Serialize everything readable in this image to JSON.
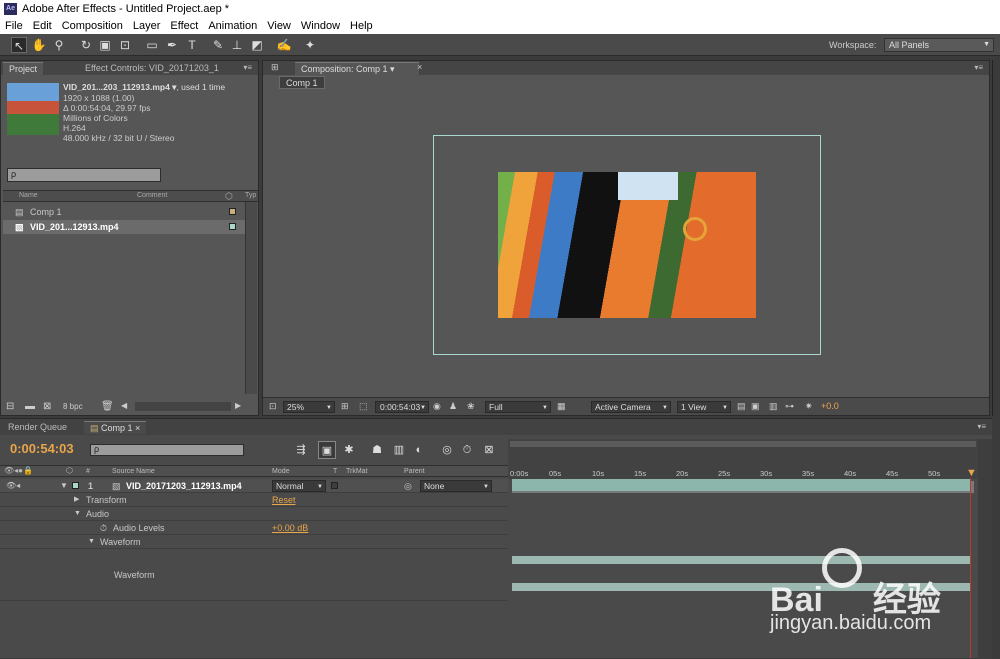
{
  "window": {
    "title": "Adobe After Effects - Untitled Project.aep *",
    "app_icon": "Ae"
  },
  "menu": [
    "File",
    "Edit",
    "Composition",
    "Layer",
    "Effect",
    "Animation",
    "View",
    "Window",
    "Help"
  ],
  "toolbar": {
    "tools": [
      "selection-tool-icon",
      "hand-tool-icon",
      "zoom-tool-icon",
      "rotate-tool-icon",
      "camera-tool-icon",
      "pan-behind-tool-icon",
      "rectangle-tool-icon",
      "pen-tool-icon",
      "type-tool-icon",
      "brush-tool-icon",
      "clone-stamp-tool-icon",
      "eraser-tool-icon",
      "roto-brush-tool-icon",
      "puppet-pin-tool-icon"
    ],
    "workspace_label": "Workspace:",
    "workspace_value": "All Panels"
  },
  "project": {
    "tabs": [
      "Project",
      "Effect Controls: VID_20171203_1"
    ],
    "selected_name": "VID_201...203_112913.mp4 ▾",
    "used": ", used 1 time",
    "info": [
      "1920 x 1088 (1.00)",
      "Δ 0:00:54:04, 29.97 fps",
      "Millions of Colors",
      "H.264",
      "48.000 kHz / 32 bit U / Stereo"
    ],
    "search_icon": "ρ",
    "columns": {
      "name": "Name",
      "comment": "Comment",
      "type": "Typ"
    },
    "items": [
      {
        "name": "Comp 1",
        "color": "#c9b07a"
      },
      {
        "name": "VID_201...12913.mp4",
        "color": "#a9d7cc"
      }
    ],
    "bpc": "8 bpc"
  },
  "composition": {
    "tab": "Composition: Comp 1",
    "sub_tab": "Comp 1",
    "zoom": "25%",
    "timecode": "0:00:54:03",
    "resolution": "Full",
    "camera": "Active Camera",
    "views": "1 View",
    "exposure": "+0.0"
  },
  "timeline": {
    "tabs": [
      "Render Queue",
      "Comp 1"
    ],
    "timecode": "0:00:54:03",
    "search_icon": "ρ",
    "columns": {
      "num": "#",
      "source": "Source Name",
      "mode": "Mode",
      "t": "T",
      "trkmat": "TrkMat",
      "parent": "Parent"
    },
    "layer": {
      "index": "1",
      "name": "VID_20171203_112913.mp4",
      "mode": "Normal",
      "parent": "None"
    },
    "props": {
      "transform": "Transform",
      "reset": "Reset",
      "audio": "Audio",
      "audio_levels": "Audio Levels",
      "audio_levels_value": "+0.00 dB",
      "waveform": "Waveform",
      "waveform2": "Waveform"
    },
    "ruler": [
      "0:00s",
      "05s",
      "10s",
      "15s",
      "20s",
      "25s",
      "30s",
      "35s",
      "40s",
      "45s",
      "50s"
    ]
  },
  "watermark": {
    "brand": "Bai",
    "brand2": "经验",
    "url": "jingyan.baidu.com"
  }
}
